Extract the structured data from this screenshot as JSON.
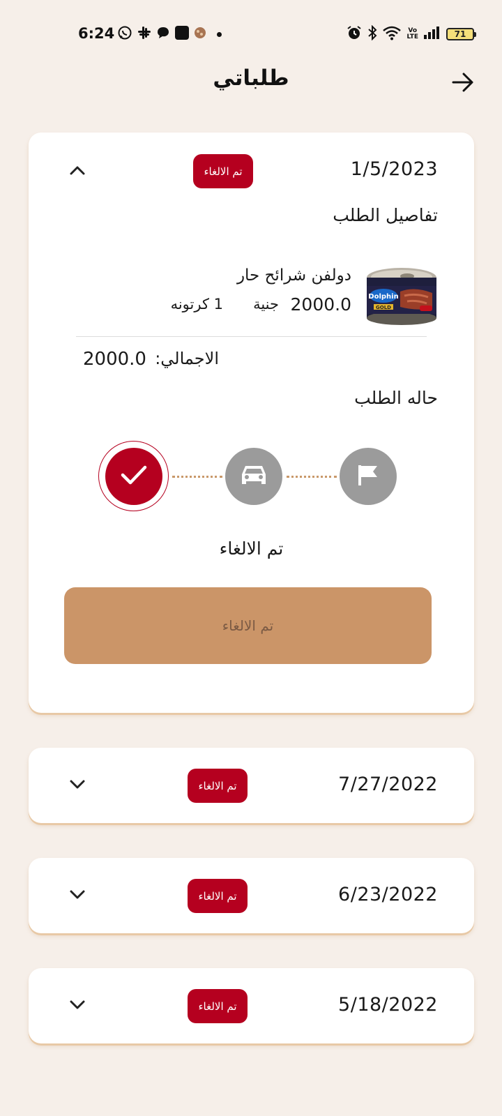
{
  "status_bar": {
    "time": "6:24",
    "battery": "71",
    "volte": "Vo LTE"
  },
  "header": {
    "title": "طلباتي",
    "back_icon": "arrow-right-icon"
  },
  "orders": [
    {
      "date": "1/5/2023",
      "status": "تم الالغاء",
      "expanded": true,
      "details_title": "تفاصيل الطلب",
      "items": [
        {
          "name": "دولفن شرائح حار",
          "price": "2000.0",
          "currency": "جنية",
          "quantity": "1 كرتونه",
          "image_brand": "Dolphin",
          "image_sub": "GOLD"
        }
      ],
      "total_label": "الاجمالي:",
      "total_value": "2000.0",
      "status_title": "حاله الطلب",
      "steps": [
        {
          "icon": "check-icon",
          "active": true
        },
        {
          "icon": "car-icon",
          "active": false
        },
        {
          "icon": "flag-icon",
          "active": false
        }
      ],
      "current_status_label": "تم الالغاء",
      "action_button_label": "تم الالغاء"
    },
    {
      "date": "7/27/2022",
      "status": "تم الالغاء",
      "expanded": false
    },
    {
      "date": "6/23/2022",
      "status": "تم الالغاء",
      "expanded": false
    },
    {
      "date": "5/18/2022",
      "status": "تم الالغاء",
      "expanded": false
    }
  ],
  "colors": {
    "background": "#f6efe9",
    "accent_red": "#b5001f",
    "accent_tan": "#cb9568",
    "step_inactive": "#9b9b9b"
  }
}
